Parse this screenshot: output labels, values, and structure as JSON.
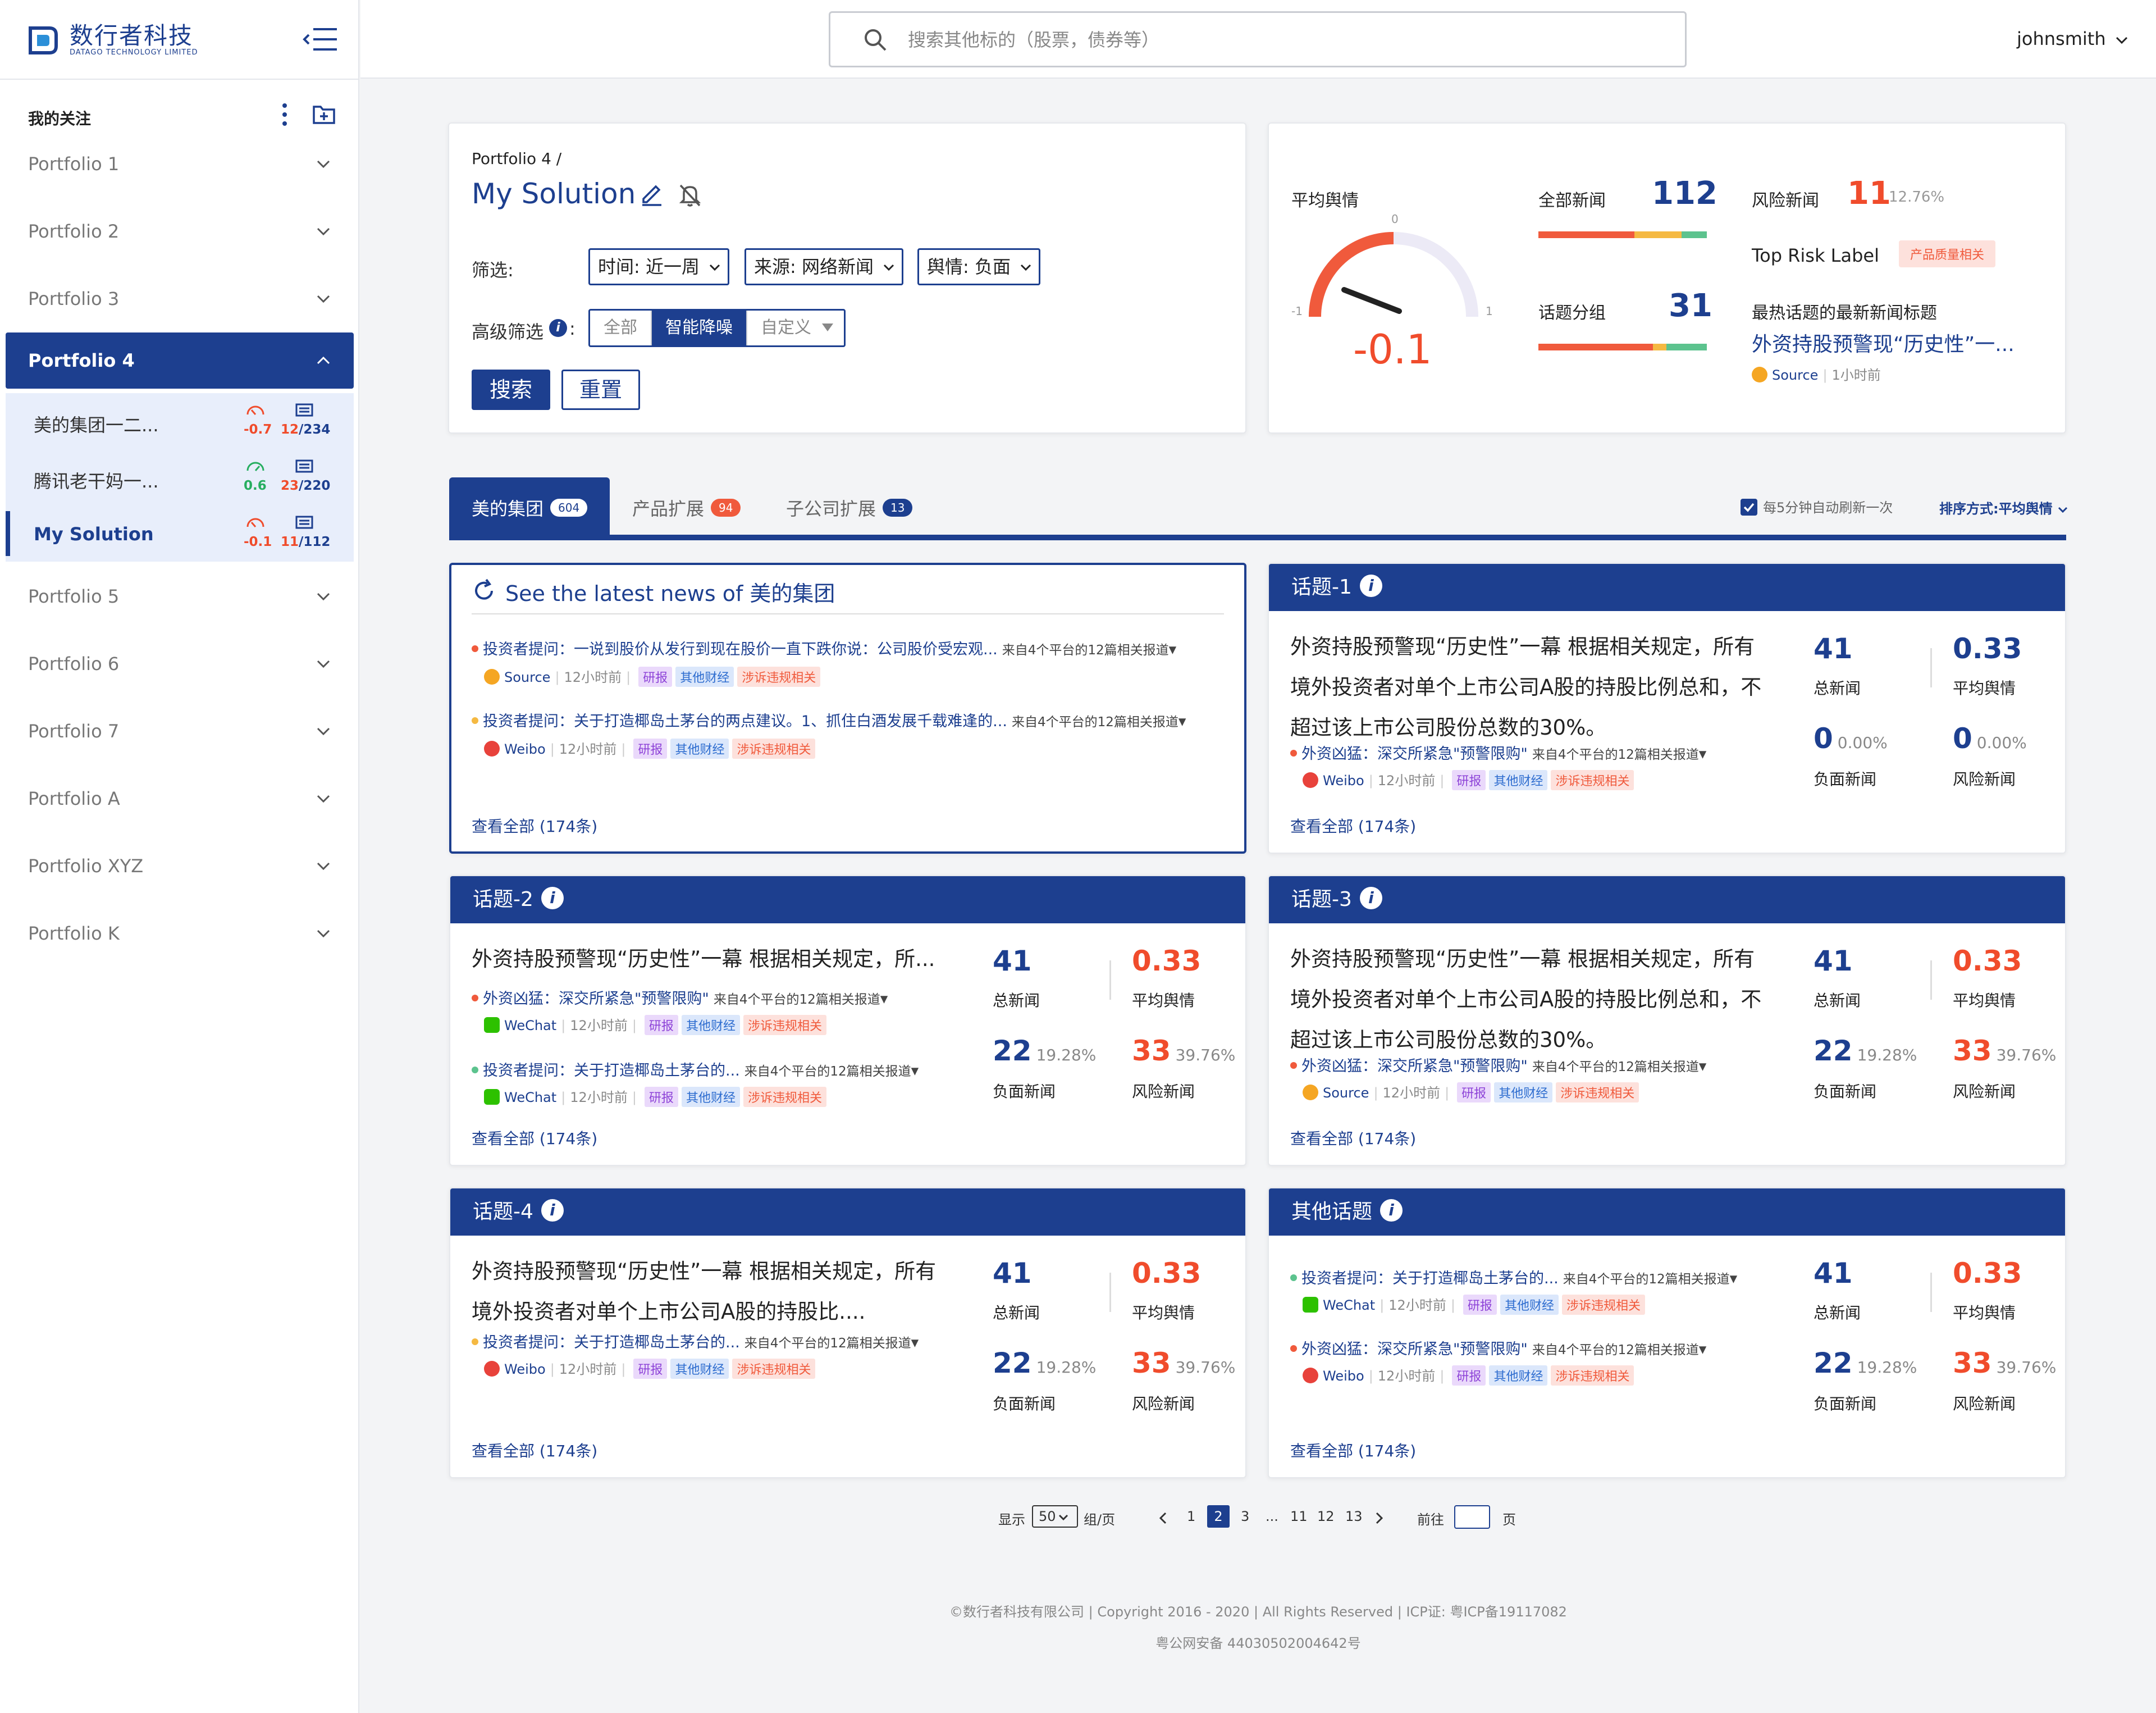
{
  "brand": {
    "name_cn": "数行者科技",
    "name_en": "DATAGO TECHNOLOGY LIMITED"
  },
  "sidebar": {
    "section_title": "我的关注",
    "portfolios": [
      {
        "label": "Portfolio 1"
      },
      {
        "label": "Portfolio 2"
      },
      {
        "label": "Portfolio 3"
      },
      {
        "label": "Portfolio 4"
      },
      {
        "label": "Portfolio 5"
      },
      {
        "label": "Portfolio 6"
      },
      {
        "label": "Portfolio 7"
      },
      {
        "label": "Portfolio A"
      },
      {
        "label": "Portfolio XYZ"
      },
      {
        "label": "Portfolio K"
      }
    ],
    "sub_items": [
      {
        "name": "美的集团一二...",
        "score": "-0.7",
        "count_a": "12",
        "count_b": "/234"
      },
      {
        "name": "腾讯老干妈一...",
        "score": "0.6",
        "count_a": "23",
        "count_b": "/220"
      },
      {
        "name": "My Solution",
        "score": "-0.1",
        "count_a": "11",
        "count_b": "/112"
      }
    ]
  },
  "header": {
    "search_placeholder": "搜索其他标的（股票，债券等）",
    "user": "johnsmith"
  },
  "solution": {
    "breadcrumb": "Portfolio 4 /",
    "title": "My Solution",
    "filter_label": "筛选:",
    "filters": [
      "时间: 近一周",
      "来源: 网络新闻",
      "舆情: 负面"
    ],
    "adv_label": "高级筛选",
    "adv_options": [
      "全部",
      "智能降噪",
      "自定义"
    ],
    "search_btn": "搜索",
    "reset_btn": "重置"
  },
  "summary": {
    "avg_label": "平均舆情",
    "gauge_min": "-1",
    "gauge_zero": "0",
    "gauge_max": "1",
    "gauge_value": "-0.1",
    "all_news_label": "全部新闻",
    "all_news": "112",
    "topic_group_label": "话题分组",
    "topic_group": "31",
    "risk_news_label": "风险新闻",
    "risk_news": "11",
    "risk_pct": "12.76%",
    "top_risk_label": "Top Risk Label",
    "top_risk_tag": "产品质量相关",
    "hot_title_label": "最热话题的最新新闻标题",
    "hot_title": "外资持股预警现“历史性”一...",
    "hot_source": "Source",
    "hot_time": "1小时前"
  },
  "tabs": [
    {
      "label": "美的集团",
      "count": "604"
    },
    {
      "label": "产品扩展",
      "count": "94"
    },
    {
      "label": "子公司扩展",
      "count": "13"
    }
  ],
  "toolbar": {
    "auto_refresh": "每5分钟自动刷新一次",
    "sort": "排序方式:平均舆情"
  },
  "latest": {
    "title": "See the latest news of 美的集团",
    "items": [
      {
        "text": "投资者提问：一说到股价从发行到现在股价一直下跌你说：公司股价受宏观...",
        "more": "来自4个平台的12篇相关报道",
        "source": "Source",
        "time": "12小时前"
      },
      {
        "text": "投资者提问：关于打造椰岛土茅台的两点建议。1、抓住白酒发展千载难逢的...",
        "more": "来自4个平台的12篇相关报道",
        "source": "Weibo",
        "time": "12小时前"
      }
    ],
    "see_all": "查看全部 (174条)"
  },
  "tags": [
    "研报",
    "其他财经",
    "涉诉违规相关"
  ],
  "topics": [
    {
      "title": "话题-1",
      "headline": "外资持股预警现“历史性”一幕 根据相关规定，所有境外投资者对单个上市公司A股的持股比例总和，不超过该上市公司股份总数的30%。",
      "news": [
        {
          "text": "外资凶猛：深交所紧急\"预警限购\"",
          "more": "来自4个平台的12篇相关报道",
          "source": "Weibo",
          "time": "12小时前"
        }
      ],
      "total": "41",
      "total_label": "总新闻",
      "avg": "0.33",
      "avg_label": "平均舆情",
      "neg": "0",
      "neg_pct": "0.00%",
      "neg_label": "负面新闻",
      "risk": "0",
      "risk_pct": "0.00%",
      "risk_label": "风险新闻",
      "see_all": "查看全部 (174条)"
    },
    {
      "title": "话题-2",
      "headline": "外资持股预警现“历史性”一幕 根据相关规定，所...",
      "news": [
        {
          "text": "外资凶猛：深交所紧急\"预警限购\"",
          "more": "来自4个平台的12篇相关报道",
          "source": "WeChat",
          "time": "12小时前"
        },
        {
          "text": "投资者提问：关于打造椰岛土茅台的...",
          "more": "来自4个平台的12篇相关报道",
          "source": "WeChat",
          "time": "12小时前"
        }
      ],
      "total": "41",
      "total_label": "总新闻",
      "avg": "0.33",
      "avg_label": "平均舆情",
      "neg": "22",
      "neg_pct": "19.28%",
      "neg_label": "负面新闻",
      "risk": "33",
      "risk_pct": "39.76%",
      "risk_label": "风险新闻",
      "see_all": "查看全部 (174条)"
    },
    {
      "title": "话题-3",
      "headline": "外资持股预警现“历史性”一幕 根据相关规定，所有境外投资者对单个上市公司A股的持股比例总和，不超过该上市公司股份总数的30%。",
      "news": [
        {
          "text": "外资凶猛：深交所紧急\"预警限购\"",
          "more": "来自4个平台的12篇相关报道",
          "source": "Source",
          "time": "12小时前"
        }
      ],
      "total": "41",
      "total_label": "总新闻",
      "avg": "0.33",
      "avg_label": "平均舆情",
      "neg": "22",
      "neg_pct": "19.28%",
      "neg_label": "负面新闻",
      "risk": "33",
      "risk_pct": "39.76%",
      "risk_label": "风险新闻",
      "see_all": "查看全部 (174条)"
    },
    {
      "title": "话题-4",
      "headline": "外资持股预警现“历史性”一幕 根据相关规定，所有境外投资者对单个上市公司A股的持股比....",
      "news": [
        {
          "text": "投资者提问：关于打造椰岛土茅台的...",
          "more": "来自4个平台的12篇相关报道",
          "source": "Weibo",
          "time": "12小时前"
        }
      ],
      "total": "41",
      "total_label": "总新闻",
      "avg": "0.33",
      "avg_label": "平均舆情",
      "neg": "22",
      "neg_pct": "19.28%",
      "neg_label": "负面新闻",
      "risk": "33",
      "risk_pct": "39.76%",
      "risk_label": "风险新闻",
      "see_all": "查看全部 (174条)"
    },
    {
      "title": "其他话题",
      "headline": "",
      "news": [
        {
          "text": "投资者提问：关于打造椰岛土茅台的...",
          "more": "来自4个平台的12篇相关报道",
          "source": "WeChat",
          "time": "12小时前"
        },
        {
          "text": "外资凶猛：深交所紧急\"预警限购\"",
          "more": "来自4个平台的12篇相关报道",
          "source": "Weibo",
          "time": "12小时前"
        }
      ],
      "total": "41",
      "total_label": "总新闻",
      "avg": "0.33",
      "avg_label": "平均舆情",
      "neg": "22",
      "neg_pct": "19.28%",
      "neg_label": "负面新闻",
      "risk": "33",
      "risk_pct": "39.76%",
      "risk_label": "风险新闻",
      "see_all": "查看全部 (174条)"
    }
  ],
  "pagination": {
    "show_label": "显示",
    "per_page": "50",
    "unit": "组/页",
    "pages": [
      "1",
      "2",
      "3",
      "...",
      "11",
      "12",
      "13"
    ],
    "current": "2",
    "goto_label": "前往",
    "goto_unit": "页"
  },
  "footer": {
    "line1": "©数行者科技有限公司 | Copyright 2016 - 2020 | All Rights Reserved | ICP证: 粤ICP备19117082",
    "line2": "粤公网安备 44030502004642号"
  },
  "colors": {
    "primary": "#1d3f8f",
    "negative": "#f04c2c",
    "positive": "#27ae60",
    "warning": "#f5b942"
  }
}
